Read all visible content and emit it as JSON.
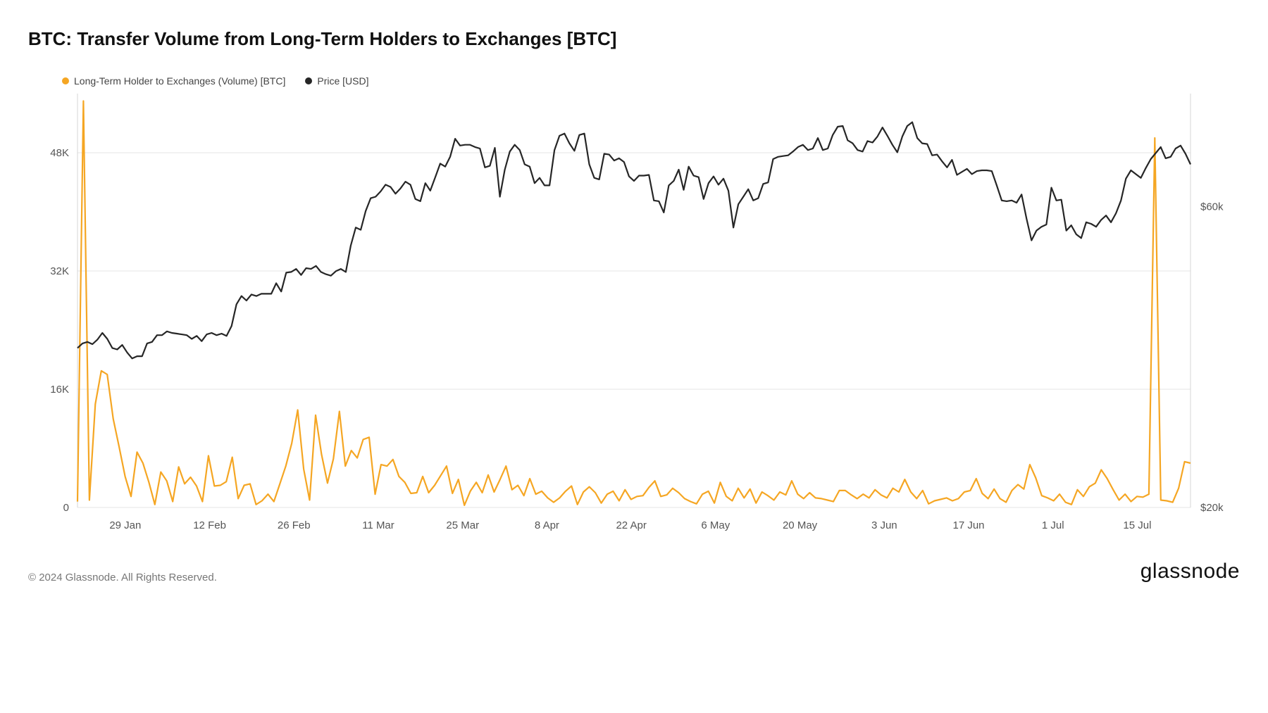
{
  "title": "BTC: Transfer Volume from Long-Term Holders to Exchanges [BTC]",
  "legend": {
    "series1": {
      "label": "Long-Term Holder to Exchanges (Volume) [BTC]",
      "color": "#f5a623"
    },
    "series2": {
      "label": "Price [USD]",
      "color": "#262626"
    }
  },
  "footer": {
    "copyright": "© 2024 Glassnode. All Rights Reserved.",
    "brand": "glassnode"
  },
  "chart_data": {
    "type": "line",
    "x_ticks": [
      "29 Jan",
      "12 Feb",
      "26 Feb",
      "11 Mar",
      "25 Mar",
      "8 Apr",
      "22 Apr",
      "6 May",
      "20 May",
      "3 Jun",
      "17 Jun",
      "1 Jul",
      "15 Jul"
    ],
    "left_axis": {
      "label": "",
      "ticks": [
        0,
        16000,
        32000,
        48000
      ],
      "tick_labels": [
        "0",
        "16K",
        "32K",
        "48K"
      ],
      "min": 0,
      "max": 56000
    },
    "right_axis": {
      "label": "",
      "ticks": [
        20000,
        60000
      ],
      "tick_labels": [
        "$20k",
        "$60k"
      ],
      "min": 20000,
      "max": 75000
    },
    "series": [
      {
        "name": "Long-Term Holder to Exchanges (Volume) [BTC]",
        "axis": "left",
        "color": "#f5a623",
        "values": [
          800,
          55000,
          1000,
          14000,
          18500,
          18000,
          12000,
          8200,
          4200,
          1500,
          7500,
          6000,
          3400,
          400,
          4800,
          3600,
          800,
          5500,
          3200,
          4100,
          2900,
          800,
          7000,
          2900,
          3000,
          3500,
          6800,
          1200,
          3000,
          3200,
          400,
          900,
          1800,
          800,
          3200,
          5600,
          8700,
          13200,
          5200,
          1000,
          12500,
          7200,
          3300,
          6600,
          13000,
          5600,
          7700,
          6700,
          9200,
          9500,
          1800,
          5800,
          5600,
          6500,
          4200,
          3400,
          1900,
          2000,
          4200,
          2000,
          3000,
          4300,
          5600,
          1900,
          3800,
          300,
          2200,
          3400,
          2000,
          4400,
          2100,
          3800,
          5600,
          2400,
          3000,
          1600,
          3900,
          1800,
          2200,
          1300,
          700,
          1300,
          2200,
          2900,
          400,
          2100,
          2800,
          2000,
          600,
          1800,
          2200,
          900,
          2400,
          1100,
          1500,
          1600,
          2700,
          3600,
          1500,
          1700,
          2600,
          2000,
          1200,
          800,
          500,
          1800,
          2200,
          600,
          3400,
          1500,
          900,
          2600,
          1300,
          2500,
          600,
          2100,
          1600,
          1000,
          2100,
          1700,
          3600,
          1800,
          1200,
          2000,
          1300,
          1200,
          1000,
          800,
          2300,
          2300,
          1700,
          1200,
          1800,
          1300,
          2400,
          1700,
          1300,
          2600,
          2100,
          3800,
          2100,
          1200,
          2300,
          500,
          900,
          1100,
          1300,
          900,
          1200,
          2100,
          2300,
          3900,
          1900,
          1200,
          2500,
          1200,
          700,
          2300,
          3100,
          2500,
          5800,
          4000,
          1600,
          1300,
          900,
          1800,
          700,
          400,
          2400,
          1500,
          2800,
          3300,
          5100,
          3900,
          2400,
          1000,
          1800,
          800,
          1500,
          1400,
          1800,
          50000,
          1000,
          900,
          700,
          2600,
          6200,
          6000
        ]
      },
      {
        "name": "Price [USD]",
        "axis": "right",
        "color": "#262626",
        "values": [
          41200,
          41800,
          42000,
          41700,
          42300,
          43200,
          42400,
          41200,
          41000,
          41600,
          40600,
          39800,
          40100,
          40100,
          41800,
          42000,
          42900,
          42900,
          43400,
          43200,
          43100,
          43000,
          42900,
          42400,
          42800,
          42100,
          43000,
          43200,
          42900,
          43100,
          42800,
          44100,
          47000,
          48100,
          47500,
          48300,
          48100,
          48400,
          48400,
          48400,
          49800,
          48700,
          51200,
          51300,
          51700,
          50900,
          51800,
          51700,
          52100,
          51300,
          51000,
          50800,
          51400,
          51700,
          51300,
          54800,
          57200,
          56900,
          59400,
          61100,
          61300,
          62000,
          62900,
          62600,
          61700,
          62400,
          63300,
          62900,
          61000,
          60700,
          63100,
          62100,
          63900,
          65700,
          65300,
          66600,
          69000,
          68100,
          68200,
          68200,
          67900,
          67700,
          65200,
          65400,
          67800,
          61300,
          64900,
          67300,
          68200,
          67500,
          65600,
          65300,
          63100,
          63800,
          62800,
          62800,
          67500,
          69400,
          69700,
          68400,
          67400,
          69500,
          69700,
          65600,
          63800,
          63600,
          67000,
          66900,
          66100,
          66400,
          65900,
          64000,
          63400,
          64100,
          64100,
          64200,
          60800,
          60700,
          59200,
          62800,
          63400,
          64900,
          62200,
          65300,
          64100,
          63900,
          61000,
          63100,
          64000,
          62900,
          63700,
          62100,
          57200,
          60300,
          61300,
          62300,
          60800,
          61100,
          63000,
          63200,
          66300,
          66600,
          66700,
          66800,
          67300,
          67900,
          68200,
          67500,
          67700,
          69100,
          67500,
          67700,
          69500,
          70600,
          70700,
          68800,
          68400,
          67500,
          67300,
          68700,
          68500,
          69300,
          70500,
          69400,
          68200,
          67200,
          69300,
          70700,
          71200,
          69100,
          68400,
          68300,
          66800,
          66900,
          66000,
          65200,
          66200,
          64200,
          64600,
          65000,
          64300,
          64700,
          64800,
          64800,
          64700,
          62800,
          60800,
          60700,
          60800,
          60500,
          61600,
          58400,
          55500,
          56800,
          57300,
          57600,
          62500,
          60800,
          60900,
          56800,
          57500,
          56300,
          55800,
          57900,
          57700,
          57300,
          58200,
          58800,
          57900,
          59100,
          60800,
          63700,
          64800,
          64300,
          63800,
          65100,
          66300,
          67100,
          67900,
          66400,
          66600,
          67700,
          68100,
          67000,
          65600
        ]
      }
    ]
  }
}
